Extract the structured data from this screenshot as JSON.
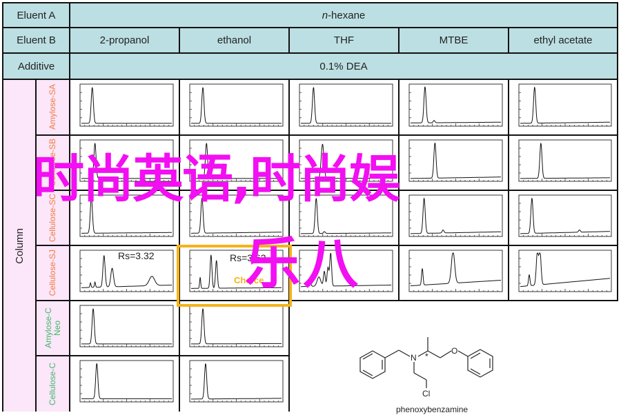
{
  "table": {
    "eluent_a_label": "Eluent A",
    "eluent_a_value": "n-hexane",
    "eluent_a_prefix": "n",
    "eluent_a_suffix": "-hexane",
    "eluent_b_label": "Eluent B",
    "eluent_b_values": [
      "2-propanol",
      "ethanol",
      "THF",
      "MTBE",
      "ethyl acetate"
    ],
    "additive_label": "Additive",
    "additive_value": "0.1% DEA",
    "column_label": "Column",
    "columns": [
      {
        "name": "Amylose-SA",
        "color": "#f07b3f"
      },
      {
        "name": "Cellulose-SB",
        "color": "#f07b3f"
      },
      {
        "name": "Cellulose-SC",
        "color": "#f07b3f"
      },
      {
        "name": "Cellulose-SJ",
        "color": "#f07b3f"
      },
      {
        "name": "Amylose-C Neo",
        "color": "#3cb86a"
      },
      {
        "name": "Cellulose-C",
        "color": "#3cb86a"
      }
    ]
  },
  "annotations": {
    "rs_1": "Rs=3.32",
    "rs_2": "Rs=3.62",
    "choice": "Choice",
    "highlight_color": "#f5b319"
  },
  "molecule": {
    "name": "phenoxybenzamine",
    "atoms": [
      "N",
      "O",
      "Cl",
      "*"
    ]
  },
  "overlay": {
    "line1": "时尚英语,时尚娱",
    "line2": "乐八",
    "color": "#f20ff2"
  },
  "chromatograms": [
    {
      "row": 0,
      "col": 0,
      "peaks": [
        [
          0.12,
          0.95,
          0.012
        ]
      ],
      "baseline": [
        0.02,
        0.02
      ]
    },
    {
      "row": 0,
      "col": 1,
      "peaks": [
        [
          0.13,
          0.95,
          0.012
        ]
      ],
      "baseline": [
        0.02,
        0.02
      ]
    },
    {
      "row": 0,
      "col": 2,
      "peaks": [
        [
          0.14,
          0.95,
          0.012
        ]
      ],
      "baseline": [
        0.02,
        0.02
      ]
    },
    {
      "row": 0,
      "col": 3,
      "peaks": [
        [
          0.16,
          0.95,
          0.012
        ],
        [
          0.26,
          0.06,
          0.01
        ]
      ],
      "baseline": [
        0.03,
        0.05
      ]
    },
    {
      "row": 0,
      "col": 4,
      "peaks": [
        [
          0.16,
          0.95,
          0.012
        ]
      ],
      "baseline": [
        0.02,
        0.05
      ]
    },
    {
      "row": 1,
      "col": 0,
      "peaks": [
        [
          0.15,
          0.95,
          0.012
        ]
      ],
      "baseline": [
        0.02,
        0.02
      ]
    },
    {
      "row": 1,
      "col": 1,
      "peaks": [
        [
          0.17,
          0.95,
          0.012
        ],
        [
          0.11,
          0.06,
          0.01
        ]
      ],
      "baseline": [
        0.02,
        0.02
      ]
    },
    {
      "row": 1,
      "col": 2,
      "peaks": [
        [
          0.24,
          0.92,
          0.015
        ]
      ],
      "baseline": [
        0.02,
        0.03
      ]
    },
    {
      "row": 1,
      "col": 3,
      "peaks": [
        [
          0.27,
          0.95,
          0.012
        ]
      ],
      "baseline": [
        0.02,
        0.06
      ]
    },
    {
      "row": 1,
      "col": 4,
      "peaks": [
        [
          0.23,
          0.95,
          0.012
        ]
      ],
      "baseline": [
        0.02,
        0.04
      ]
    },
    {
      "row": 2,
      "col": 0,
      "peaks": [
        [
          0.11,
          0.95,
          0.012
        ]
      ],
      "baseline": [
        0.03,
        0.05
      ]
    },
    {
      "row": 2,
      "col": 1,
      "peaks": [
        [
          0.12,
          0.95,
          0.012
        ]
      ],
      "baseline": [
        0.03,
        0.06
      ]
    },
    {
      "row": 2,
      "col": 2,
      "peaks": [
        [
          0.17,
          0.95,
          0.012
        ],
        [
          0.26,
          0.05,
          0.01
        ]
      ],
      "baseline": [
        0.02,
        0.04
      ]
    },
    {
      "row": 2,
      "col": 3,
      "peaks": [
        [
          0.15,
          0.95,
          0.012
        ],
        [
          0.36,
          0.08,
          0.01
        ]
      ],
      "baseline": [
        0.02,
        0.07
      ]
    },
    {
      "row": 2,
      "col": 4,
      "peaks": [
        [
          0.13,
          0.95,
          0.012
        ],
        [
          0.66,
          0.06,
          0.01
        ]
      ],
      "baseline": [
        0.02,
        0.08
      ]
    },
    {
      "row": 3,
      "col": 0,
      "peaks": [
        [
          0.1,
          0.12,
          0.006
        ],
        [
          0.15,
          0.14,
          0.006
        ],
        [
          0.25,
          0.85,
          0.012
        ],
        [
          0.34,
          0.5,
          0.015
        ],
        [
          0.78,
          0.25,
          0.03
        ]
      ],
      "baseline": [
        0.05,
        0.12
      ]
    },
    {
      "row": 3,
      "col": 1,
      "peaks": [
        [
          0.1,
          0.3,
          0.006
        ],
        [
          0.22,
          0.9,
          0.01
        ],
        [
          0.28,
          0.75,
          0.01
        ]
      ],
      "baseline": [
        0.03,
        0.05
      ]
    },
    {
      "row": 3,
      "col": 2,
      "peaks": [
        [
          0.1,
          0.15,
          0.01
        ],
        [
          0.2,
          0.25,
          0.02
        ],
        [
          0.26,
          0.4,
          0.01
        ],
        [
          0.3,
          0.5,
          0.01
        ],
        [
          0.33,
          0.9,
          0.01
        ]
      ],
      "baseline": [
        0.08,
        0.12
      ]
    },
    {
      "row": 3,
      "col": 3,
      "peaks": [
        [
          0.13,
          0.45,
          0.008
        ],
        [
          0.47,
          0.85,
          0.018
        ]
      ],
      "baseline": [
        0.1,
        0.25
      ]
    },
    {
      "row": 3,
      "col": 4,
      "peaks": [
        [
          0.1,
          0.3,
          0.008
        ],
        [
          0.19,
          0.85,
          0.012
        ],
        [
          0.22,
          0.88,
          0.012
        ]
      ],
      "baseline": [
        0.08,
        0.3
      ]
    },
    {
      "row": 4,
      "col": 0,
      "peaks": [
        [
          0.13,
          0.95,
          0.012
        ]
      ],
      "baseline": [
        0.02,
        0.02
      ]
    },
    {
      "row": 4,
      "col": 1,
      "peaks": [
        [
          0.13,
          0.95,
          0.012
        ]
      ],
      "baseline": [
        0.02,
        0.03
      ]
    },
    {
      "row": 5,
      "col": 0,
      "peaks": [
        [
          0.17,
          0.95,
          0.012
        ]
      ],
      "baseline": [
        0.03,
        0.03
      ]
    },
    {
      "row": 5,
      "col": 1,
      "peaks": [
        [
          0.16,
          0.95,
          0.012
        ]
      ],
      "baseline": [
        0.02,
        0.04
      ]
    }
  ]
}
